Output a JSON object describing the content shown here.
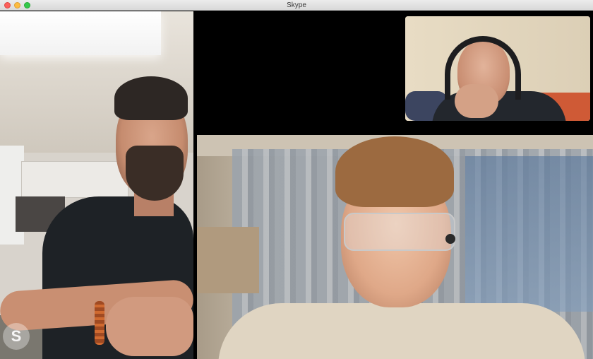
{
  "window": {
    "title": "Skype"
  },
  "participants": [
    {
      "role": "left-video"
    },
    {
      "role": "bottom-video"
    },
    {
      "role": "self-preview"
    }
  ],
  "badge": {
    "letter": "S"
  },
  "colors": {
    "close": "#fc605c",
    "minimize": "#fdbc40",
    "maximize": "#34c84a",
    "background": "#000000"
  }
}
